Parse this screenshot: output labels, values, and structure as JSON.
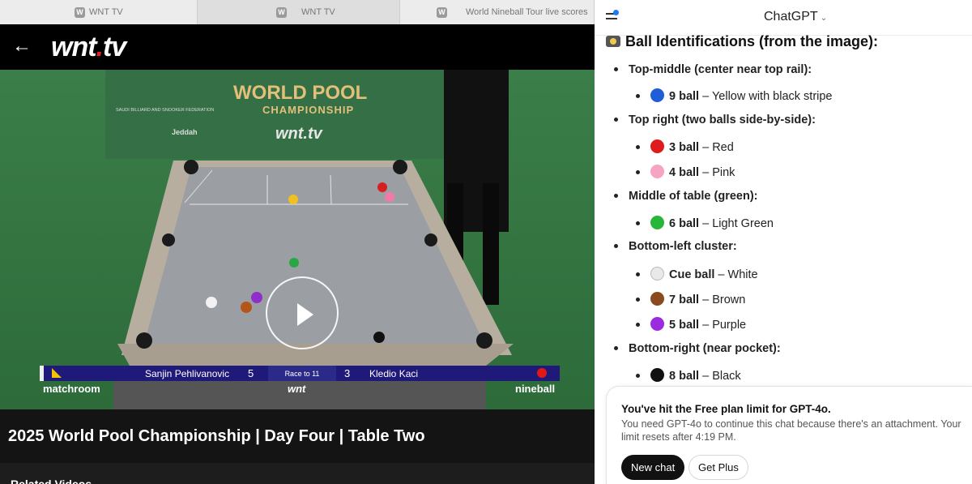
{
  "browser": {
    "tabs": [
      {
        "label": "WNT TV",
        "favicon": "W"
      },
      {
        "label": "WNT TV",
        "favicon": "W"
      },
      {
        "label": "World Nineball Tour live scores",
        "favicon": "W"
      }
    ]
  },
  "site": {
    "back_icon": "back-arrow-icon",
    "logo_text": "wnt",
    "logo_dot": ".",
    "logo_tld": "tv"
  },
  "video": {
    "banner_title_1": "WORLD POOL",
    "banner_title_2": "CHAMPIONSHIP",
    "banner_brand": "wnt.tv",
    "banner_federation": "SAUDI BILLIARD AND SNOOKER FEDERATION",
    "banner_city": "Jeddah",
    "player1": "Sanjin Pehlivanovic",
    "score1": "5",
    "race": "Race to 11",
    "score2": "3",
    "player2": "Kledio Kaci",
    "brand_left": "matchroom",
    "brand_mid": "wnt",
    "brand_right": "nineball",
    "title": "2025 World Pool Championship | Day Four | Table Two",
    "related_heading": "Related Videos"
  },
  "chat": {
    "model": "ChatGPT",
    "heading": "Ball Identifications (from the image):",
    "sections": [
      {
        "label": "Top-middle (center near top rail):",
        "items": [
          {
            "name": "9 ball",
            "desc": " – Yellow with black stripe",
            "color": "#1e5fd8"
          }
        ]
      },
      {
        "label": "Top right (two balls side-by-side):",
        "items": [
          {
            "name": "3 ball",
            "desc": " – Red",
            "color": "#e01b1b"
          },
          {
            "name": "4 ball",
            "desc": " – Pink",
            "color": "#f7a3c4"
          }
        ]
      },
      {
        "label": "Middle of table (green):",
        "items": [
          {
            "name": "6 ball",
            "desc": " – Light Green",
            "color": "#27b53a"
          }
        ]
      },
      {
        "label": "Bottom-left cluster:",
        "items": [
          {
            "name": "Cue ball",
            "desc": " – White",
            "color": "#e9e9e9"
          },
          {
            "name": "7 ball",
            "desc": " – Brown",
            "color": "#8a4a1f"
          },
          {
            "name": "5 ball",
            "desc": " – Purple",
            "color": "#9b2be0"
          }
        ]
      },
      {
        "label": "Bottom-right (near pocket):",
        "items": [
          {
            "name": "8 ball",
            "desc": " – Black",
            "color": "#111111"
          }
        ]
      }
    ],
    "limit": {
      "title": "You've hit the Free plan limit for GPT-4o.",
      "body": "You need GPT-4o to continue this chat because there's an attachment. Your limit resets after 4:19 PM.",
      "new_chat": "New chat",
      "get_plus": "Get Plus"
    }
  }
}
